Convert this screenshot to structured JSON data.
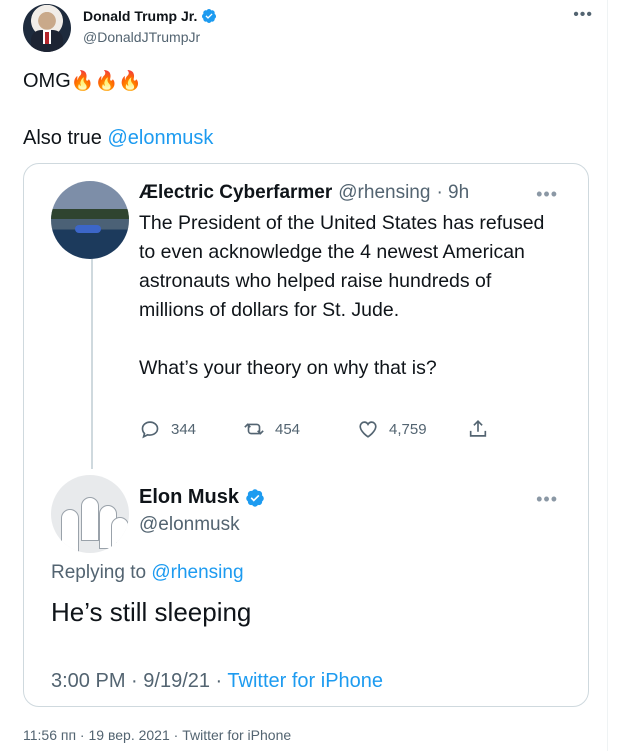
{
  "tweet": {
    "author": {
      "name": "Donald Trump Jr.",
      "handle": "@DonaldJTrumpJr"
    },
    "text_line1": "OMG",
    "fire_emoji": "🔥🔥🔥",
    "text_line2_prefix": "Also true ",
    "mention": "@elonmusk",
    "footer": {
      "time": "11:56 пп",
      "date": "19 вер. 2021",
      "separator": " · ",
      "source": "Twitter for iPhone"
    }
  },
  "quote": {
    "original": {
      "name": "Ælectric Cyberfarmer",
      "handle": "@rhensing",
      "age": "· 9h",
      "body": "The President of the United States has refused to even acknowledge the 4 newest American astronauts who helped raise hundreds of millions of dollars for St. Jude.\n\nWhat’s your theory on why that is?",
      "actions": {
        "replies": "344",
        "retweets": "454",
        "likes": "4,759"
      }
    },
    "reply": {
      "name": "Elon Musk",
      "handle": "@elonmusk",
      "replying_prefix": "Replying to ",
      "replying_mention": "@rhensing",
      "text": "He’s still sleeping",
      "time": "3:00 PM",
      "date": "9/19/21",
      "separator": " · ",
      "source": "Twitter for iPhone"
    }
  },
  "colors": {
    "accent": "#1d9bf0",
    "secondary_text": "#536471",
    "border": "#cfd9de"
  },
  "icons": [
    "verified-badge-icon",
    "more-icon",
    "reply-icon",
    "retweet-icon",
    "like-icon",
    "share-icon"
  ]
}
